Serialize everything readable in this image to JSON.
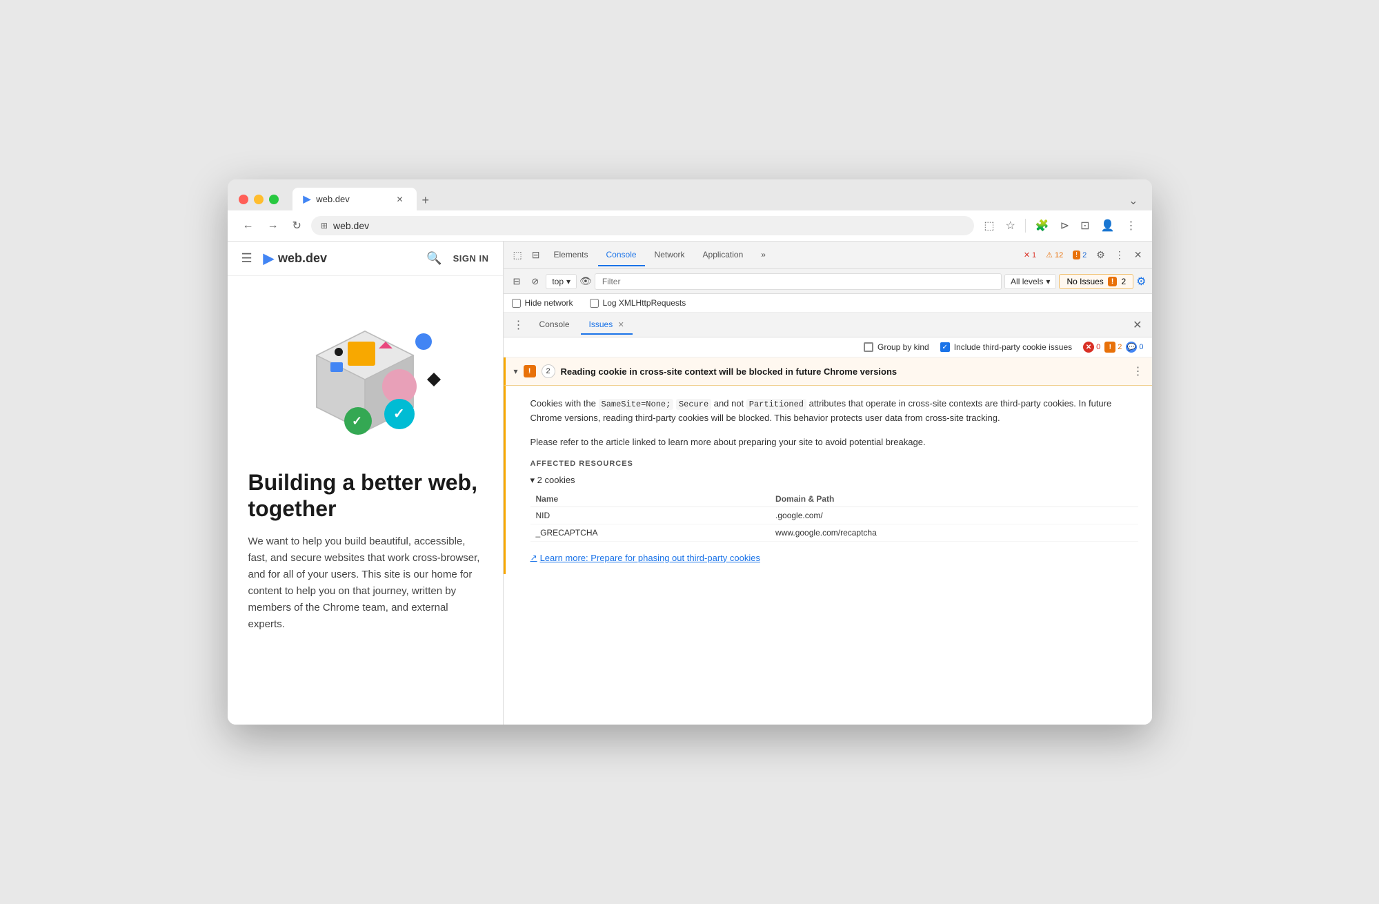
{
  "browser": {
    "tab_title": "web.dev",
    "url": "web.dev",
    "new_tab_icon": "+",
    "dropdown_icon": "⌄"
  },
  "nav": {
    "back": "←",
    "forward": "→",
    "refresh": "↻",
    "url_icon": "⊞",
    "screen_cast": "📺",
    "bookmark": "☆",
    "extension": "🧩",
    "debug": "⊳",
    "split": "⊡",
    "profile": "👤",
    "more": "⋮"
  },
  "website": {
    "nav": {
      "hamburger": "☰",
      "logo": "web.dev",
      "search": "🔍",
      "sign_in": "SIGN IN"
    },
    "hero_title": "Building a better web, together",
    "hero_desc": "We want to help you build beautiful, accessible, fast, and secure websites that work cross-browser, and for all of your users. This site is our home for content to help you on that journey, written by members of the Chrome team, and external experts."
  },
  "devtools": {
    "tabs": [
      {
        "label": "Elements",
        "active": false
      },
      {
        "label": "Console",
        "active": true
      },
      {
        "label": "Network",
        "active": false
      },
      {
        "label": "Application",
        "active": false
      },
      {
        "label": "»",
        "active": false
      }
    ],
    "error_count": "1",
    "warn_count": "12",
    "info_count": "2",
    "toolbar": {
      "sidebar_icon": "⊟",
      "block_icon": "⊘",
      "top_label": "top",
      "eye_icon": "👁",
      "filter_placeholder": "Filter",
      "all_levels_label": "All levels",
      "no_issues_label": "No Issues",
      "no_issues_count": "2",
      "settings_icon": "⚙"
    },
    "checkboxes": {
      "hide_network": "Hide network",
      "log_xml": "Log XMLHttpRequests"
    },
    "issues_tabs": [
      {
        "label": "Console",
        "active": false
      },
      {
        "label": "Issues",
        "active": true
      }
    ],
    "options": {
      "group_by_kind": "Group by kind",
      "include_third_party": "Include third-party cookie issues"
    },
    "counts": {
      "error": "0",
      "warn": "2",
      "info": "0"
    },
    "issue": {
      "title": "Reading cookie in cross-site context will be blocked in future Chrome versions",
      "count": "2",
      "desc1": "Cookies with the",
      "code1": "SameSite=None;",
      "code2": "Secure",
      "desc2": "and not",
      "code3": "Partitioned",
      "desc3": "attributes that operate in cross-site contexts are third-party cookies. In future Chrome versions, reading third-party cookies will be blocked. This behavior protects user data from cross-site tracking.",
      "desc4": "Please refer to the article linked to learn more about preparing your site to avoid potential breakage.",
      "affected_label": "AFFECTED RESOURCES",
      "cookies_header": "▾ 2 cookies",
      "col_name": "Name",
      "col_domain": "Domain & Path",
      "cookies": [
        {
          "name": "NID",
          "domain": ".google.com/"
        },
        {
          "name": "_GRECAPTCHA",
          "domain": "www.google.com/recaptcha"
        }
      ],
      "learn_more_text": "Learn more: Prepare for phasing out third-party cookies"
    }
  }
}
